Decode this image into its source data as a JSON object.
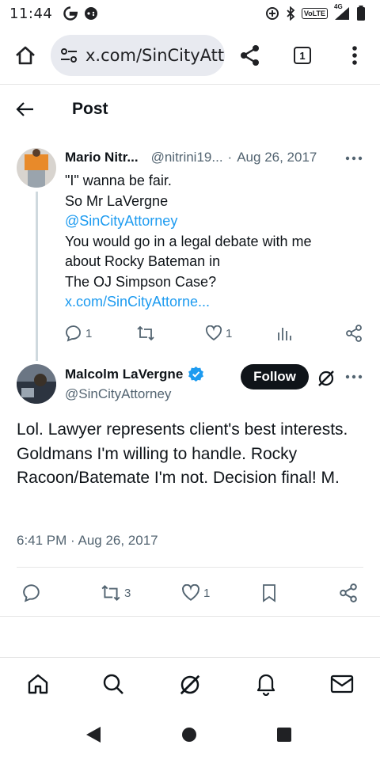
{
  "status_bar": {
    "time": "11:44",
    "left_icons": [
      "google-g-icon",
      "game-controller-icon"
    ],
    "right_icons": [
      "data-saver-icon",
      "bluetooth-icon",
      "volte-icon",
      "signal-icon",
      "battery-icon"
    ],
    "volte_label": "VoLTE",
    "network_label": "4G"
  },
  "browser": {
    "url": "x.com/SinCityAttorney",
    "tab_count": "1"
  },
  "header": {
    "title": "Post"
  },
  "parent_tweet": {
    "name": "Mario Nitr...",
    "handle": "@nitrini19...",
    "separator": "·",
    "date": "Aug 26, 2017",
    "lines": [
      "\"I\" wanna be fair.",
      "So Mr LaVergne",
      "@SinCityAttorney",
      "You would go in a legal debate with me",
      "about Rocky Bateman in",
      "The OJ Simpson Case?",
      "x.com/SinCityAttorne..."
    ],
    "reply_count": "1",
    "like_count": "1"
  },
  "main_tweet": {
    "name": "Malcolm LaVergne",
    "handle": "@SinCityAttorney",
    "follow_label": "Follow",
    "text": "Lol.  Lawyer represents client's best interests.  Goldmans I'm willing to handle.  Rocky Racoon/Batemate I'm not.  Decision final!  M.",
    "timestamp": "6:41 PM · Aug 26, 2017",
    "repost_count": "3",
    "like_count": "1"
  },
  "colors": {
    "link": "#1d9bf0",
    "text": "#0f1419",
    "muted": "#536471",
    "verified": "#1d9bf0"
  }
}
